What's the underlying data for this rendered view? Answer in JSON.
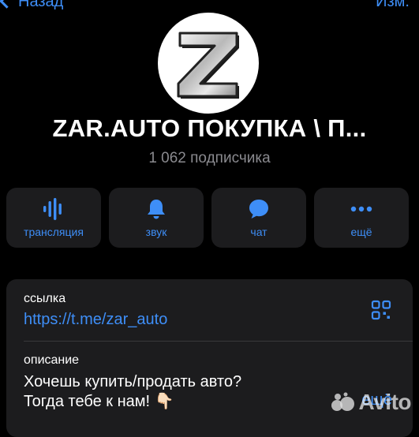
{
  "nav": {
    "back_label": "Назад",
    "edit_label": "Изм."
  },
  "channel": {
    "avatar_letter": "Z",
    "title": "ZAR.AUTO ПОКУПКА \\ П...",
    "subscribers": "1 062 подписчика"
  },
  "actions": [
    {
      "label": "трансляция",
      "icon": "broadcast-icon"
    },
    {
      "label": "звук",
      "icon": "bell-icon"
    },
    {
      "label": "чат",
      "icon": "chat-bubble-icon"
    },
    {
      "label": "ещё",
      "icon": "more-dots-icon"
    }
  ],
  "info": {
    "link_label": "ссылка",
    "link_value": "https://t.me/zar_auto",
    "description_label": "описание",
    "description_text": "Хочешь купить/продать авто?\nТогда тебе к нам! 👇🏻",
    "more_label": "ещё"
  },
  "colors": {
    "accent": "#3e8ef7",
    "card_bg": "#1c1c1e",
    "background": "#000000",
    "secondary_text": "#8a8a8f"
  }
}
